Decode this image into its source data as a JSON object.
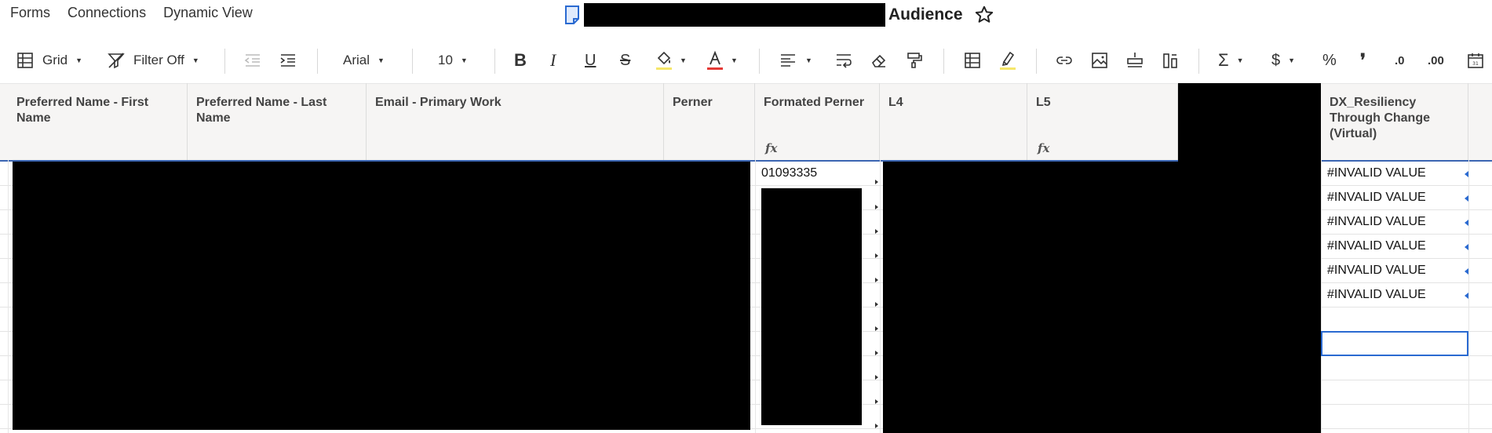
{
  "menu": {
    "forms": "Forms",
    "connections": "Connections",
    "dynamic_view": "Dynamic View"
  },
  "document": {
    "title_suffix": "Audience",
    "icon": "sheet-doc-icon"
  },
  "toolbar": {
    "view_label": "Grid",
    "filter_label": "Filter Off",
    "font_family": "Arial",
    "font_size": "10",
    "icons": [
      "grid-icon",
      "filter-icon",
      "outdent-icon",
      "indent-icon",
      "bold-icon",
      "italic-icon",
      "underline-icon",
      "strikethrough-icon",
      "fill-color-icon",
      "text-color-icon",
      "align-icon",
      "wrap-text-icon",
      "eraser-icon",
      "format-painter-icon",
      "table-icon",
      "highlight-icon",
      "link-icon",
      "image-icon",
      "insert-row-icon",
      "insert-column-icon",
      "sum-icon",
      "currency-icon",
      "percent-icon",
      "comma-icon",
      "decrease-decimal-icon",
      "increase-decimal-icon",
      "date-icon"
    ],
    "text_color": "#e53935",
    "highlight_color": "#f5e66a"
  },
  "columns": {
    "first_name": "Preferred Name - First Name",
    "last_name": "Preferred Name - Last Name",
    "email": "Email - Primary Work",
    "perner": "Perner",
    "formated_perner": "Formated Perner",
    "l4": "L4",
    "l5": "L5",
    "dx": "DX_Resiliency Through Change (Virtual)"
  },
  "cells": {
    "formated_perner_row1": "01093335",
    "dx_values": [
      "#INVALID VALUE",
      "#INVALID VALUE",
      "#INVALID VALUE",
      "#INVALID VALUE",
      "#INVALID VALUE",
      "#INVALID VALUE"
    ]
  },
  "colors": {
    "selection": "#2a6ad1",
    "header_bg": "#f6f5f4"
  }
}
